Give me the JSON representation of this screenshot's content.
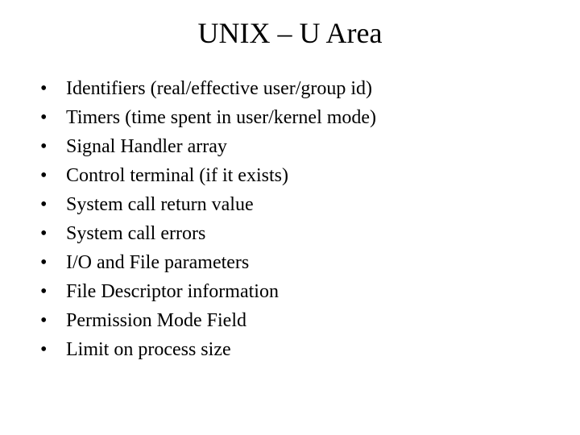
{
  "title": "UNIX – U Area",
  "bullets": [
    "Identifiers (real/effective user/group id)",
    "Timers (time spent in user/kernel mode)",
    "Signal Handler array",
    "Control terminal (if it exists)",
    "System call return value",
    "System call errors",
    "I/O and File parameters",
    "File Descriptor information",
    "Permission Mode Field",
    "Limit on process size"
  ]
}
